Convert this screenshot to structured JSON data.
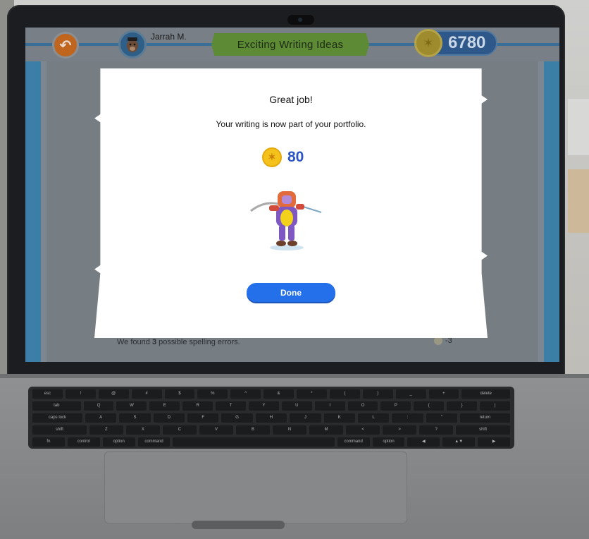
{
  "app": {
    "user_name": "Jarrah M.",
    "page_title": "Exciting Writing Ideas",
    "coin_balance": "6780",
    "spelling": {
      "prefix": "We found ",
      "count": "3",
      "suffix": " possible spelling errors.",
      "penalty": "-3"
    }
  },
  "modal": {
    "title": "Great job!",
    "message": "Your writing is now part of your portfolio.",
    "reward_value": "80",
    "done_label": "Done"
  },
  "keyboard": {
    "row1": [
      "esc",
      "!",
      "@",
      "#",
      "$",
      "%",
      "^",
      "&",
      "*",
      "(",
      ")",
      "_",
      "+",
      "delete"
    ],
    "row2": [
      "tab",
      "Q",
      "W",
      "E",
      "R",
      "T",
      "Y",
      "U",
      "I",
      "O",
      "P",
      "{",
      "}",
      "|"
    ],
    "row3": [
      "caps lock",
      "A",
      "S",
      "D",
      "F",
      "G",
      "H",
      "J",
      "K",
      "L",
      ":",
      "\"",
      "return"
    ],
    "row4": [
      "shift",
      "Z",
      "X",
      "C",
      "V",
      "B",
      "N",
      "M",
      "<",
      ">",
      "?",
      "shift"
    ],
    "row5": [
      "fn",
      "control",
      "option",
      "command",
      "",
      "command",
      "option",
      "◀",
      "▲▼",
      "▶"
    ]
  },
  "colors": {
    "accent_blue": "#2470ea",
    "reward_blue": "#2b55c8",
    "coin_gold": "#f4c21a",
    "banner_green": "#5d8a35"
  },
  "icons": {
    "back": "back-arrow-icon",
    "coin": "coin-icon",
    "avatar": "dog-avatar-icon"
  }
}
